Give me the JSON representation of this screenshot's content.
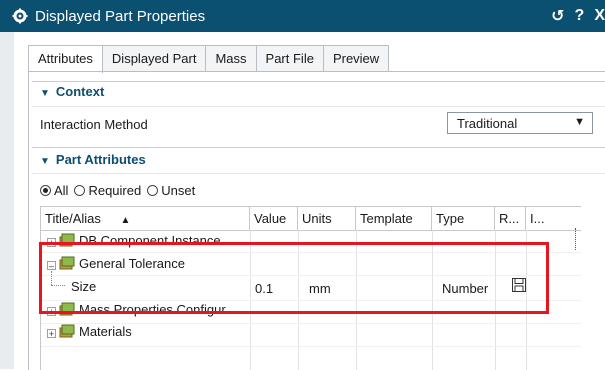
{
  "window": {
    "title": "Displayed Part Properties",
    "controls": [
      "↺",
      "?",
      "X"
    ]
  },
  "tabs": [
    "Attributes",
    "Displayed Part",
    "Mass",
    "Part File",
    "Preview"
  ],
  "context": {
    "header": "Context",
    "interaction_label": "Interaction Method",
    "interaction_value": "Traditional"
  },
  "part_attributes": {
    "header": "Part Attributes",
    "filters": [
      {
        "label": "All",
        "selected": true
      },
      {
        "label": "Required",
        "selected": false
      },
      {
        "label": "Unset",
        "selected": false
      }
    ],
    "columns": [
      "Title/Alias",
      "Value",
      "Units",
      "Template",
      "Type",
      "R...",
      "I..."
    ],
    "rows": [
      {
        "title": "DB Component Instance",
        "value": "",
        "units": "",
        "template": "",
        "type": ""
      },
      {
        "title": "General Tolerance",
        "value": "",
        "units": "",
        "template": "",
        "type": ""
      },
      {
        "title": "Size",
        "value": "0.1",
        "units": "mm",
        "template": "",
        "type": "Number"
      },
      {
        "title": "Mass Properties Configur...",
        "value": "",
        "units": "",
        "template": "",
        "type": ""
      },
      {
        "title": "Materials",
        "value": "",
        "units": "",
        "template": "",
        "type": ""
      }
    ]
  },
  "colors": {
    "titlebar": "#0b4f71",
    "accent": "#0b4f71",
    "highlight_box": "#e8141f"
  }
}
